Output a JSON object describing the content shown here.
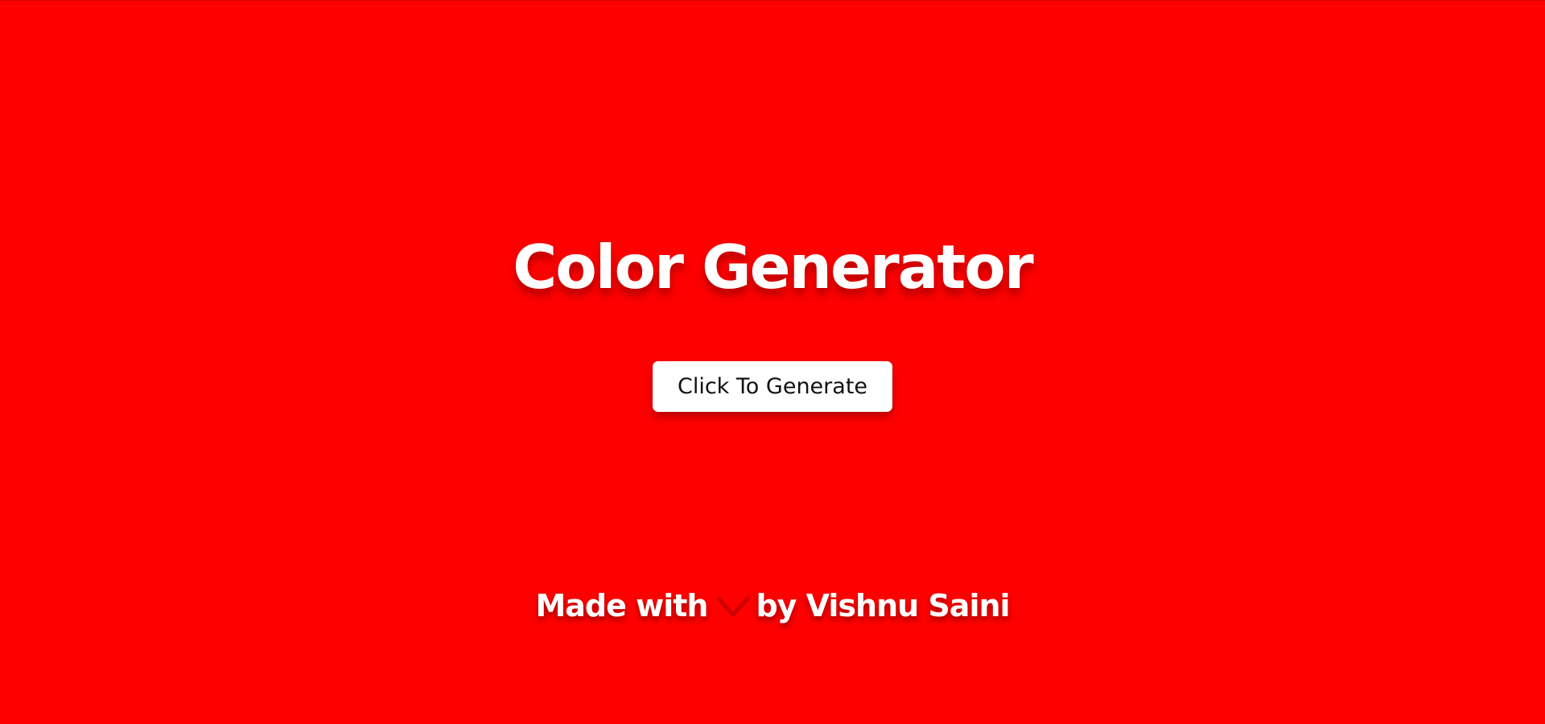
{
  "page": {
    "title": "Color Generator",
    "button_label": "Click To Generate",
    "footer": {
      "prefix": "Made with",
      "icon": "heart-icon",
      "suffix": "by Vishnu Saini"
    }
  },
  "colors": {
    "background": "#fe0000",
    "text": "#ffffff",
    "button_background": "#ffffff",
    "button_text": "#111111"
  }
}
